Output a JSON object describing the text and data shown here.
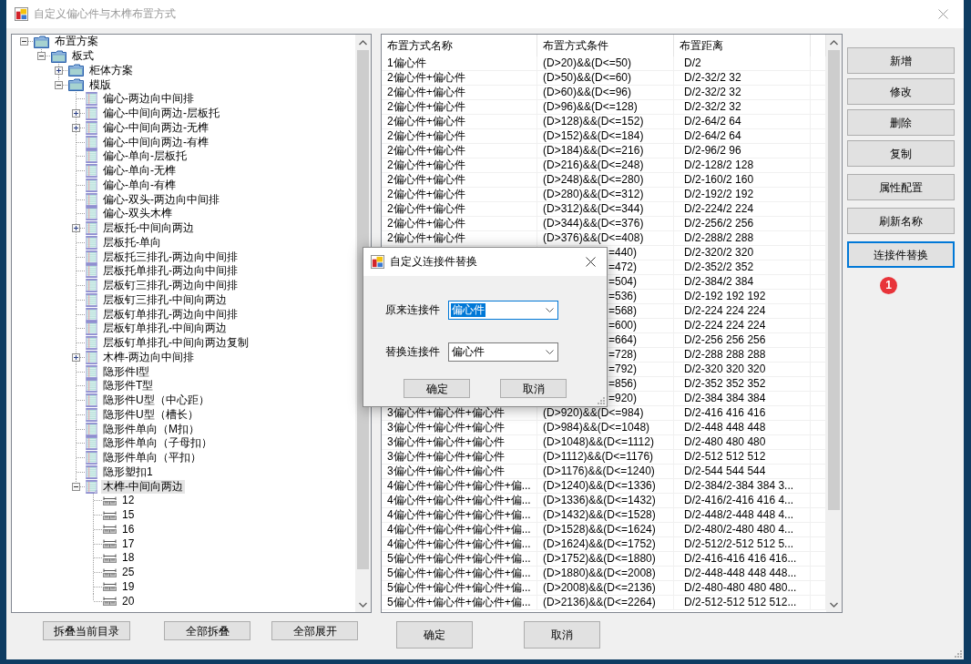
{
  "window": {
    "title": "自定义偏心件与木榫布置方式"
  },
  "tree": {
    "nodes": [
      {
        "label": "布置方案",
        "kind": "folder",
        "expanded": true,
        "selected": false,
        "children": [
          {
            "label": "板式",
            "kind": "folder",
            "expanded": true,
            "selected": false,
            "children": [
              {
                "label": "柜体方案",
                "kind": "folder",
                "expanded": false,
                "selected": false
              },
              {
                "label": "模版",
                "kind": "folder",
                "expanded": true,
                "selected": false,
                "children": [
                  {
                    "label": "偏心-两边向中间排",
                    "kind": "template",
                    "selected": false
                  },
                  {
                    "label": "偏心-中间向两边-层板托",
                    "kind": "template",
                    "expanded": false,
                    "selected": false
                  },
                  {
                    "label": "偏心-中间向两边-无榫",
                    "kind": "template",
                    "expanded": false,
                    "selected": false
                  },
                  {
                    "label": "偏心-中间向两边-有榫",
                    "kind": "template",
                    "selected": false
                  },
                  {
                    "label": "偏心-单向-层板托",
                    "kind": "template",
                    "selected": false
                  },
                  {
                    "label": "偏心-单向-无榫",
                    "kind": "template",
                    "selected": false
                  },
                  {
                    "label": "偏心-单向-有榫",
                    "kind": "template",
                    "selected": false
                  },
                  {
                    "label": "偏心-双头-两边向中间排",
                    "kind": "template",
                    "selected": false
                  },
                  {
                    "label": "偏心-双头木榫",
                    "kind": "template",
                    "selected": false
                  },
                  {
                    "label": "层板托-中间向两边",
                    "kind": "template",
                    "expanded": false,
                    "selected": false
                  },
                  {
                    "label": "层板托-单向",
                    "kind": "template",
                    "selected": false
                  },
                  {
                    "label": "层板托三排孔-两边向中间排",
                    "kind": "template",
                    "selected": false
                  },
                  {
                    "label": "层板托单排孔-两边向中间排",
                    "kind": "template",
                    "selected": false
                  },
                  {
                    "label": "层板钉三排孔-两边向中间排",
                    "kind": "template",
                    "selected": false
                  },
                  {
                    "label": "层板钉三排孔-中间向两边",
                    "kind": "template",
                    "selected": false
                  },
                  {
                    "label": "层板钉单排孔-两边向中间排",
                    "kind": "template",
                    "selected": false
                  },
                  {
                    "label": "层板钉单排孔-中间向两边",
                    "kind": "template",
                    "selected": false
                  },
                  {
                    "label": "层板钉单排孔-中间向两边复制",
                    "kind": "template",
                    "selected": false
                  },
                  {
                    "label": "木榫-两边向中间排",
                    "kind": "template",
                    "expanded": false,
                    "selected": false
                  },
                  {
                    "label": "隐形件I型",
                    "kind": "template",
                    "selected": false
                  },
                  {
                    "label": "隐形件T型",
                    "kind": "template",
                    "selected": false
                  },
                  {
                    "label": "隐形件U型（中心距）",
                    "kind": "template",
                    "selected": false
                  },
                  {
                    "label": "隐形件U型（槽长）",
                    "kind": "template",
                    "selected": false
                  },
                  {
                    "label": "隐形件单向（M扣）",
                    "kind": "template",
                    "selected": false
                  },
                  {
                    "label": "隐形件单向（子母扣）",
                    "kind": "template",
                    "selected": false
                  },
                  {
                    "label": "隐形件单向（平扣）",
                    "kind": "template",
                    "selected": false
                  },
                  {
                    "label": "隐形塑扣1",
                    "kind": "template",
                    "selected": false
                  },
                  {
                    "label": "木榫-中间向两边",
                    "kind": "template",
                    "expanded": true,
                    "selected": true,
                    "children": [
                      {
                        "label": "12",
                        "kind": "size",
                        "selected": false
                      },
                      {
                        "label": "15",
                        "kind": "size",
                        "selected": false
                      },
                      {
                        "label": "16",
                        "kind": "size",
                        "selected": false
                      },
                      {
                        "label": "17",
                        "kind": "size",
                        "selected": false
                      },
                      {
                        "label": "18",
                        "kind": "size",
                        "selected": false
                      },
                      {
                        "label": "25",
                        "kind": "size",
                        "selected": false
                      },
                      {
                        "label": "19",
                        "kind": "size",
                        "selected": false
                      },
                      {
                        "label": "20",
                        "kind": "size",
                        "selected": false
                      }
                    ]
                  }
                ]
              }
            ]
          }
        ]
      }
    ]
  },
  "tree_buttons": [
    "拆叠当前目录",
    "全部拆叠",
    "全部展开"
  ],
  "table": {
    "columns": [
      "布置方式名称",
      "布置方式条件",
      "布置距离"
    ],
    "rows": [
      {
        "name": "1偏心件",
        "condition": "(D>20)&&(D<=50)",
        "distance": "D/2"
      },
      {
        "name": "2偏心件+偏心件",
        "condition": "(D>50)&&(D<=60)",
        "distance": "D/2-32/2 32"
      },
      {
        "name": "2偏心件+偏心件",
        "condition": "(D>60)&&(D<=96)",
        "distance": "D/2-32/2 32"
      },
      {
        "name": "2偏心件+偏心件",
        "condition": "(D>96)&&(D<=128)",
        "distance": "D/2-32/2 32"
      },
      {
        "name": "2偏心件+偏心件",
        "condition": "(D>128)&&(D<=152)",
        "distance": "D/2-64/2 64"
      },
      {
        "name": "2偏心件+偏心件",
        "condition": "(D>152)&&(D<=184)",
        "distance": "D/2-64/2 64"
      },
      {
        "name": "2偏心件+偏心件",
        "condition": "(D>184)&&(D<=216)",
        "distance": "D/2-96/2 96"
      },
      {
        "name": "2偏心件+偏心件",
        "condition": "(D>216)&&(D<=248)",
        "distance": "D/2-128/2 128"
      },
      {
        "name": "2偏心件+偏心件",
        "condition": "(D>248)&&(D<=280)",
        "distance": "D/2-160/2 160"
      },
      {
        "name": "2偏心件+偏心件",
        "condition": "(D>280)&&(D<=312)",
        "distance": "D/2-192/2 192"
      },
      {
        "name": "2偏心件+偏心件",
        "condition": "(D>312)&&(D<=344)",
        "distance": "D/2-224/2 224"
      },
      {
        "name": "2偏心件+偏心件",
        "condition": "(D>344)&&(D<=376)",
        "distance": "D/2-256/2 256"
      },
      {
        "name": "2偏心件+偏心件",
        "condition": "(D>376)&&(D<=408)",
        "distance": "D/2-288/2 288"
      },
      {
        "condition": "=440)",
        "distance": "D/2-320/2 320"
      },
      {
        "condition": "=472)",
        "distance": "D/2-352/2 352"
      },
      {
        "condition": "=504)",
        "distance": "D/2-384/2 384"
      },
      {
        "condition": "=536)",
        "distance": "D/2-192 192 192"
      },
      {
        "condition": "=568)",
        "distance": "D/2-224 224 224"
      },
      {
        "condition": "=600)",
        "distance": "D/2-224 224 224"
      },
      {
        "condition": "=664)",
        "distance": "D/2-256 256 256"
      },
      {
        "condition": "=728)",
        "distance": "D/2-288 288 288"
      },
      {
        "condition": "=792)",
        "distance": "D/2-320 320 320"
      },
      {
        "condition": "=856)",
        "distance": "D/2-352 352 352"
      },
      {
        "condition": "=920)",
        "distance": "D/2-384 384 384"
      },
      {
        "name": "3偏心件+偏心件+偏心件",
        "condition": "(D>920)&&(D<=984)",
        "distance": "D/2-416 416 416"
      },
      {
        "name": "3偏心件+偏心件+偏心件",
        "condition": "(D>984)&&(D<=1048)",
        "distance": "D/2-448 448 448"
      },
      {
        "name": "3偏心件+偏心件+偏心件",
        "condition": "(D>1048)&&(D<=1112)",
        "distance": "D/2-480 480 480"
      },
      {
        "name": "3偏心件+偏心件+偏心件",
        "condition": "(D>1112)&&(D<=1176)",
        "distance": "D/2-512 512 512"
      },
      {
        "name": "3偏心件+偏心件+偏心件",
        "condition": "(D>1176)&&(D<=1240)",
        "distance": "D/2-544 544 544"
      },
      {
        "name": "4偏心件+偏心件+偏心件+偏...",
        "condition": "(D>1240)&&(D<=1336)",
        "distance": "D/2-384/2-384 384 3..."
      },
      {
        "name": "4偏心件+偏心件+偏心件+偏...",
        "condition": "(D>1336)&&(D<=1432)",
        "distance": "D/2-416/2-416 416 4..."
      },
      {
        "name": "4偏心件+偏心件+偏心件+偏...",
        "condition": "(D>1432)&&(D<=1528)",
        "distance": "D/2-448/2-448 448 4..."
      },
      {
        "name": "4偏心件+偏心件+偏心件+偏...",
        "condition": "(D>1528)&&(D<=1624)",
        "distance": "D/2-480/2-480 480 4..."
      },
      {
        "name": "4偏心件+偏心件+偏心件+偏...",
        "condition": "(D>1624)&&(D<=1752)",
        "distance": "D/2-512/2-512 512 5..."
      },
      {
        "name": "5偏心件+偏心件+偏心件+偏...",
        "condition": "(D>1752)&&(D<=1880)",
        "distance": "D/2-416-416 416 416..."
      },
      {
        "name": "5偏心件+偏心件+偏心件+偏...",
        "condition": "(D>1880)&&(D<=2008)",
        "distance": "D/2-448-448 448 448..."
      },
      {
        "name": "5偏心件+偏心件+偏心件+偏...",
        "condition": "(D>2008)&&(D<=2136)",
        "distance": "D/2-480-480 480 480..."
      },
      {
        "name": "5偏心件+偏心件+偏心件+偏...",
        "condition": "(D>2136)&&(D<=2264)",
        "distance": "D/2-512-512 512 512..."
      }
    ]
  },
  "table_buttons": [
    "确定",
    "取消"
  ],
  "side_buttons": [
    {
      "label": "新增",
      "focused": false
    },
    {
      "label": "修改",
      "focused": false
    },
    {
      "label": "删除",
      "focused": false
    },
    {
      "label": "复制",
      "focused": false
    },
    {
      "label": "属性配置",
      "focused": false
    },
    {
      "label": "刷新名称",
      "focused": false
    },
    {
      "label": "连接件替换",
      "focused": true
    }
  ],
  "badge": "1",
  "dialog": {
    "title": "自定义连接件替换",
    "fields": [
      {
        "label": "原来连接件",
        "value": "偏心件",
        "focused": true
      },
      {
        "label": "替换连接件",
        "value": "偏心件",
        "focused": false
      }
    ],
    "buttons": [
      "确定",
      "取消"
    ]
  }
}
